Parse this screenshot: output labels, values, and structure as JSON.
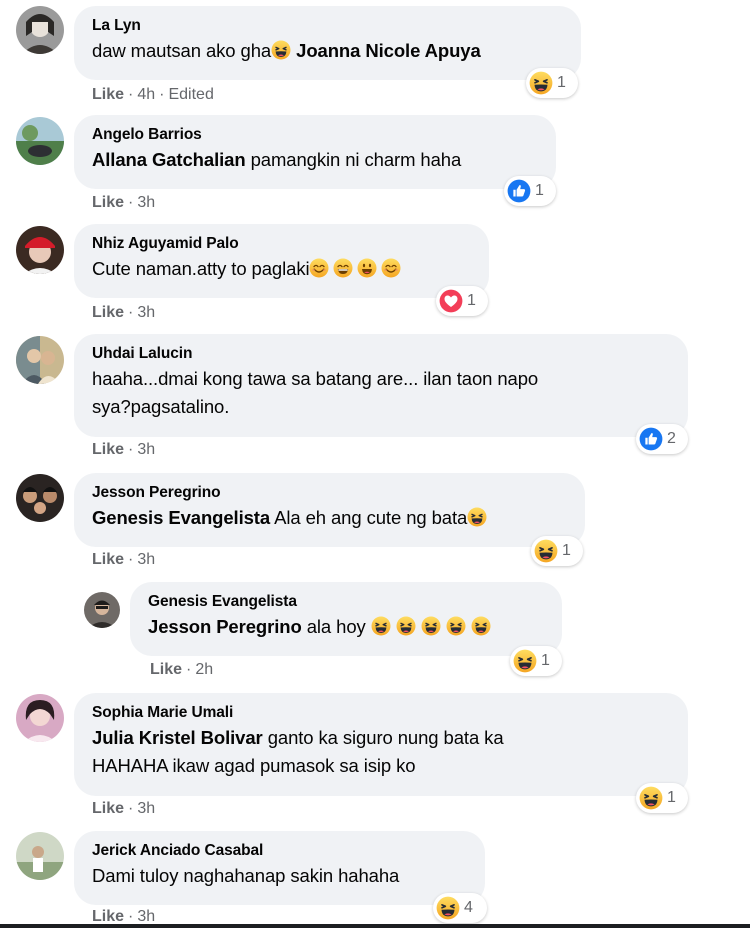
{
  "comments": [
    {
      "author": "La Lyn",
      "text": "daw mautsan ako gha",
      "tag": "Joanna Nicole Apuya",
      "like": "Like",
      "time": "4h",
      "edited": "Edited",
      "reaction": "haha",
      "count": "1"
    },
    {
      "author": "Angelo Barrios",
      "tag": "Allana Gatchalian",
      "text": "pamangkin ni charm haha",
      "like": "Like",
      "time": "3h",
      "reaction": "like",
      "count": "1"
    },
    {
      "author": "Nhiz Aguyamid Palo",
      "text": "Cute naman.atty to paglaki",
      "like": "Like",
      "time": "3h",
      "reaction": "love",
      "count": "1"
    },
    {
      "author": "Uhdai Lalucin",
      "text_line1": "haaha...dmai kong tawa sa batang are... ilan taon napo",
      "text_line2": "sya?pagsatalino.",
      "like": "Like",
      "time": "3h",
      "reaction": "like",
      "count": "2"
    },
    {
      "author": "Jesson Peregrino",
      "tag": "Genesis Evangelista",
      "text": "Ala eh ang cute ng bata",
      "like": "Like",
      "time": "3h",
      "reaction": "haha",
      "count": "1"
    },
    {
      "author": "Genesis Evangelista",
      "tag": "Jesson Peregrino",
      "text": "ala hoy",
      "like": "Like",
      "time": "2h",
      "reaction": "haha",
      "count": "1"
    },
    {
      "author": "Sophia Marie Umali",
      "tag": "Julia Kristel Bolivar",
      "text_line1": "ganto ka siguro nung bata ka",
      "text_line2": "HAHAHA ikaw agad pumasok sa isip ko",
      "like": "Like",
      "time": "3h",
      "reaction": "haha",
      "count": "1"
    },
    {
      "author": "Jerick Anciado Casabal",
      "text": "Dami tuloy naghahanap sakin hahaha",
      "like": "Like",
      "time": "3h",
      "reaction": "haha",
      "count": "4"
    }
  ],
  "colors": {
    "bubble": "#f0f2f5",
    "meta": "#65676b",
    "like_blue": "#1877f2",
    "love_red": "#f33e58",
    "haha_yellow": "#f7b125"
  }
}
